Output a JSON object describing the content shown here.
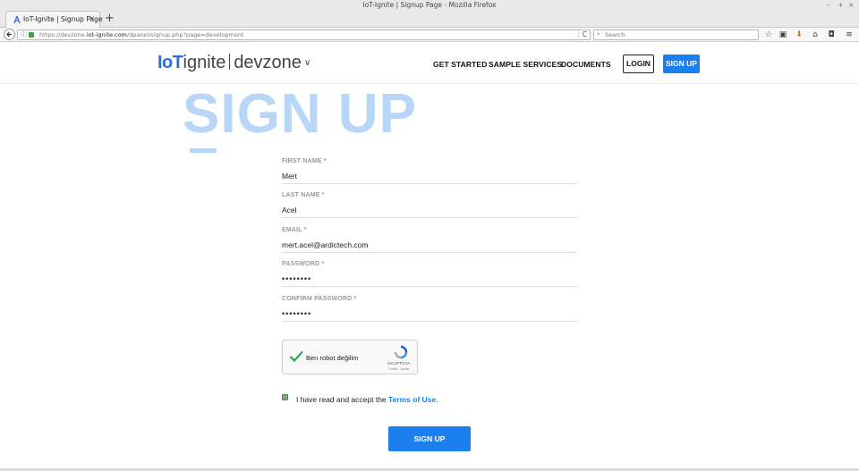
{
  "window": {
    "title": "IoT-Ignite | Signup Page - Mozilla Firefox",
    "controls": [
      "–",
      "+",
      "×"
    ]
  },
  "browser": {
    "tab_title": "IoT-Ignite | Signup Page",
    "tab_close": "×",
    "new_tab": "+",
    "url_info": "ⓘ",
    "url_prefix": "https://devzone.",
    "url_domain": "iot-ignite.com",
    "url_path": "/dpanel/signup.php?page=development",
    "reload": "C",
    "search_placeholder": "Search",
    "search_icon": "🔍"
  },
  "site": {
    "logo_iot": "IoT",
    "logo_ignite": "ignite",
    "logo_devzone": "devzone",
    "logo_chevron": "∨",
    "nav": {
      "get_started": "GET STARTED",
      "sample_services": "SAMPLE SERVICES",
      "documents": "DOCUMENTS",
      "login": "LOGIN",
      "signup": "SIGN UP"
    }
  },
  "page": {
    "heading": "SIGN UP"
  },
  "form": {
    "first_name": {
      "label": "FIRST NAME *",
      "value": "Mert"
    },
    "last_name": {
      "label": "LAST NAME *",
      "value": "Acel"
    },
    "email": {
      "label": "EMAIL *",
      "value": "mert.acel@ardictech.com"
    },
    "password": {
      "label": "PASSWORD *",
      "value": "••••••••"
    },
    "confirm_password": {
      "label": "CONFIRM PASSWORD *",
      "value": "••••••••"
    },
    "recaptcha": {
      "label": "Ben robot değilim",
      "brand": "reCAPTCHA",
      "terms": "Gizlilik - Şartlar",
      "checked": true
    },
    "terms": {
      "prefix": "I have read and accept the ",
      "link": "Terms of Use",
      "suffix": ".",
      "checked": true
    },
    "submit": "SIGN UP"
  },
  "colors": {
    "accent": "#1c7ff0",
    "hero": "#b8d6f8",
    "check_green": "#1e9e4f"
  }
}
